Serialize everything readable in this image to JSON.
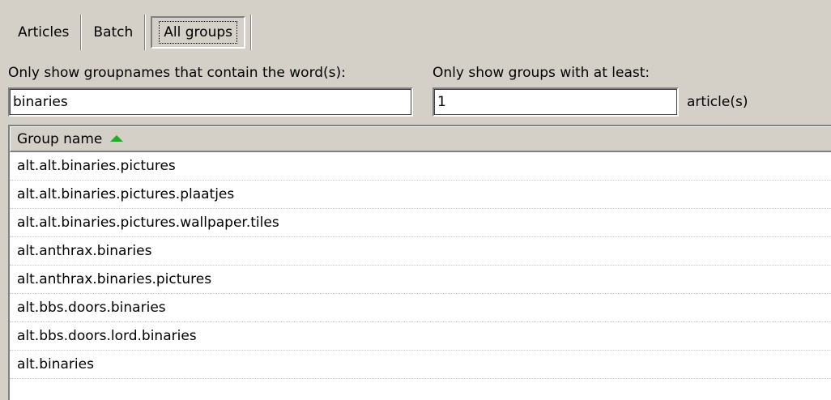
{
  "tabs": [
    {
      "label": "Articles",
      "active": false
    },
    {
      "label": "Batch",
      "active": false
    },
    {
      "label": "All groups",
      "active": true
    }
  ],
  "filters": {
    "words_label": "Only show groupnames that contain the word(s):",
    "words_value": "binaries",
    "min_label": "Only show groups with at least:",
    "min_value": "1",
    "min_suffix": "article(s)"
  },
  "list": {
    "column_header": "Group name",
    "sort": "ascending",
    "sort_icon_color": "#1fae1f",
    "rows": [
      "alt.alt.binaries.pictures",
      "alt.alt.binaries.pictures.plaatjes",
      "alt.alt.binaries.pictures.wallpaper.tiles",
      "alt.anthrax.binaries",
      "alt.anthrax.binaries.pictures",
      "alt.bbs.doors.binaries",
      "alt.bbs.doors.lord.binaries",
      "alt.binaries"
    ]
  }
}
